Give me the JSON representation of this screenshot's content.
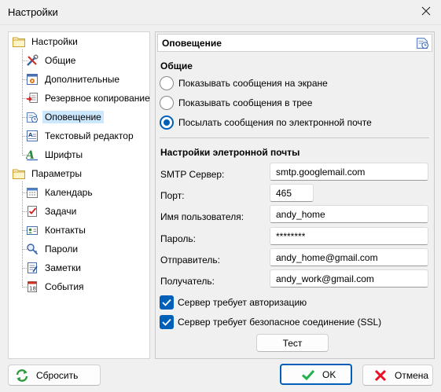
{
  "window": {
    "title": "Настройки",
    "close_glyph": "✕"
  },
  "tree": {
    "groups": [
      {
        "label": "Настройки",
        "icon": "folder-icon",
        "items": [
          {
            "label": "Общие",
            "icon": "tools-icon"
          },
          {
            "label": "Дополнительные",
            "icon": "advanced-settings-icon"
          },
          {
            "label": "Резервное копирование",
            "icon": "backup-icon"
          },
          {
            "label": "Оповещение",
            "icon": "notification-icon",
            "selected": true
          },
          {
            "label": "Текстовый редактор",
            "icon": "text-editor-icon"
          },
          {
            "label": "Шрифты",
            "icon": "font-icon"
          }
        ]
      },
      {
        "label": "Параметры",
        "icon": "folder-icon",
        "items": [
          {
            "label": "Календарь",
            "icon": "calendar-icon"
          },
          {
            "label": "Задачи",
            "icon": "tasks-icon"
          },
          {
            "label": "Контакты",
            "icon": "contacts-icon"
          },
          {
            "label": "Пароли",
            "icon": "passwords-icon"
          },
          {
            "label": "Заметки",
            "icon": "notes-icon"
          },
          {
            "label": "События",
            "icon": "events-icon"
          }
        ]
      }
    ]
  },
  "panel": {
    "header": "Оповещение",
    "general": {
      "title": "Общие",
      "options": [
        {
          "label": "Показывать сообщения на экране",
          "selected": false
        },
        {
          "label": "Показывать сообщения в трее",
          "selected": false
        },
        {
          "label": "Посылать сообщения по электронной почте",
          "selected": true
        }
      ]
    },
    "email": {
      "title": "Настройки элетронной почты",
      "smtp_label": "SMTP Сервер:",
      "smtp_value": "smtp.googlemail.com",
      "port_label": "Порт:",
      "port_value": "465",
      "user_label": "Имя пользователя:",
      "user_value": "andy_home",
      "password_label": "Пароль:",
      "password_value": "********",
      "sender_label": "Отправитель:",
      "sender_value": "andy_home@gmail.com",
      "recipient_label": "Получатель:",
      "recipient_value": "andy_work@gmail.com",
      "auth_label": "Сервер требует авторизацию",
      "auth_checked": true,
      "ssl_label": "Сервер требует безопасное соединение (SSL)",
      "ssl_checked": true,
      "test_button": "Тест"
    }
  },
  "buttons": {
    "reset": "Сбросить",
    "ok": "OK",
    "cancel": "Отмена"
  },
  "colors": {
    "accent": "#005fb8",
    "selection": "#cce8ff",
    "ok_check": "#22b14c",
    "cancel_x": "#e81123"
  }
}
